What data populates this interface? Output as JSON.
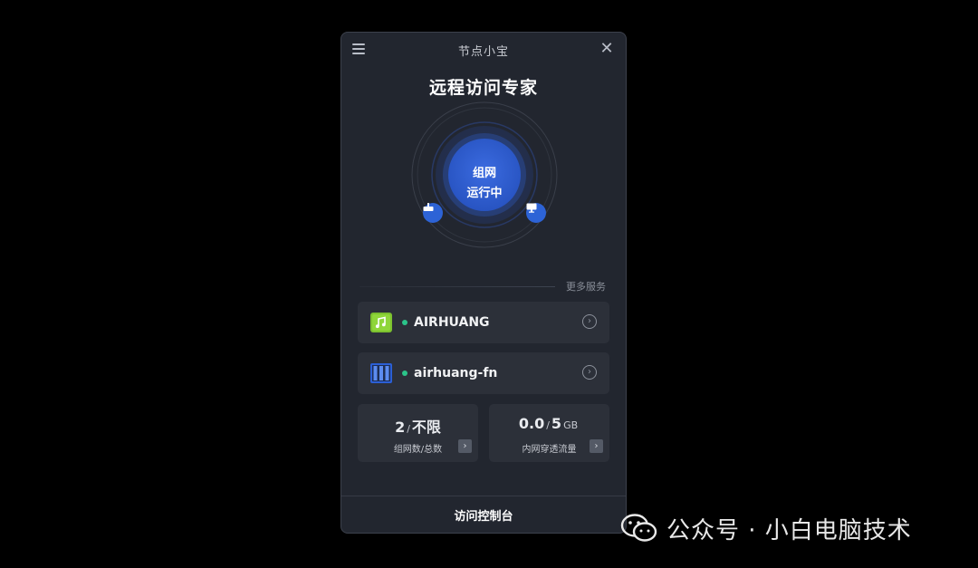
{
  "window": {
    "title": "节点小宝",
    "headline": "远程访问专家"
  },
  "status": {
    "line1": "组网",
    "line2": "运行中"
  },
  "section": {
    "more_services": "更多服务"
  },
  "devices": [
    {
      "name": "AIRHUANG",
      "status": "online",
      "icon": "music-app-icon"
    },
    {
      "name": "airhuang-fn",
      "status": "online",
      "icon": "nas-server-icon"
    }
  ],
  "stats": [
    {
      "value": "2",
      "sep": "/",
      "suffix": "不限",
      "label": "组网数/总数"
    },
    {
      "value": "0.0",
      "sep": "/",
      "suffix": "5",
      "unit": "GB",
      "label": "内网穿透流量"
    }
  ],
  "footer": {
    "console_label": "访问控制台"
  },
  "watermark": {
    "text": "公众号 · 小白电脑技术"
  },
  "colors": {
    "background": "#000000",
    "panel": "#22262f",
    "card": "#2c3039",
    "accent_blue": "#2d63d6",
    "online_green": "#2bc48a"
  }
}
